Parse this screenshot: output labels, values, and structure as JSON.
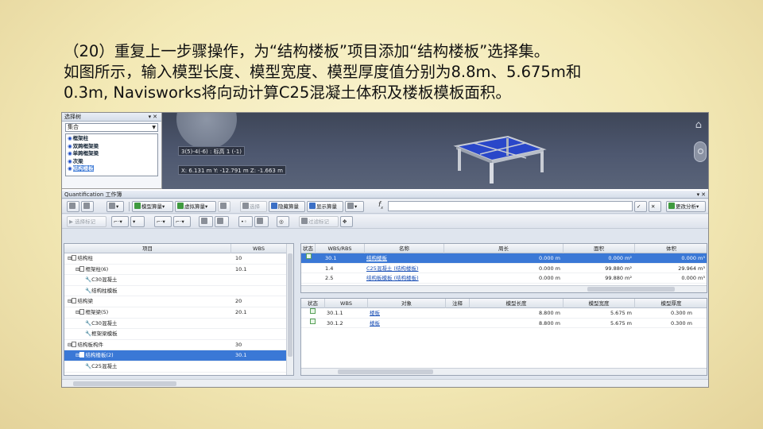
{
  "slide": {
    "line1": "（20）重复上一步骤操作，为“结构楼板”项目添加“结构楼板”选择集。",
    "line2": "如图所示，输入模型长度、模型宽度、模型厚度值分别为8.8m、5.675m和",
    "line3": "0.3m, Navisworks将向动计算C25混凝土体积及楼板模板面积。"
  },
  "selection_tree": {
    "title": "选择树",
    "dropdown_value": "集合",
    "items": [
      {
        "label": "框架柱"
      },
      {
        "label": "双跨框架梁"
      },
      {
        "label": "单跨框架梁"
      },
      {
        "label": "次梁"
      },
      {
        "label": "结构楼板",
        "selected": true
      }
    ]
  },
  "viewport": {
    "tip1": "3(5)-4(-6) : 标高 1 (-1)",
    "tip2": "X: 6.131 m  Y: -12.791 m  Z: -1.663 m"
  },
  "quantification": {
    "title": "Quantification 工作簿",
    "toolbar1": {
      "model_takeoff": "模型算量",
      "virtual_takeoff": "虚拟算量",
      "select": "选择",
      "hide_takeoff": "隐藏算量",
      "show_takeoff": "显示算量",
      "change_analysis": "更改分析"
    },
    "toolbar2": {
      "select_mark": "选择标记",
      "filter_mark": "过滤标记"
    },
    "fx": "f",
    "tree_headers": {
      "item": "项目",
      "wbs": "WBS"
    },
    "tree_rows": [
      {
        "label": "结构柱",
        "wbs": "10",
        "level": 0
      },
      {
        "label": "框架柱(6)",
        "wbs": "10.1",
        "level": 1
      },
      {
        "label": "C30混凝土",
        "wbs": "",
        "level": 2
      },
      {
        "label": "结构柱模板",
        "wbs": "",
        "level": 2
      },
      {
        "label": "结构梁",
        "wbs": "20",
        "level": 0
      },
      {
        "label": "框架梁(5)",
        "wbs": "20.1",
        "level": 1
      },
      {
        "label": "C30混凝土",
        "wbs": "",
        "level": 2
      },
      {
        "label": "框架梁模板",
        "wbs": "",
        "level": 2
      },
      {
        "label": "结构板构件",
        "wbs": "30",
        "level": 0
      },
      {
        "label": "结构楼板(2)",
        "wbs": "30.1",
        "level": 1,
        "selected": true
      },
      {
        "label": "C25混凝土",
        "wbs": "",
        "level": 2
      }
    ],
    "grid1_headers": {
      "status": "状态",
      "wbs": "WBS/RBS",
      "name": "名称",
      "perimeter": "周长",
      "area": "面积",
      "volume": "体积"
    },
    "grid1_rows": [
      {
        "wbs": "30.1",
        "name": "结构楼板",
        "perimeter": "0.000 m",
        "area": "0.000 m²",
        "volume": "0.000 m³",
        "selected": true
      },
      {
        "wbs": "1.4",
        "name": "C25混凝土 (结构楼板)",
        "perimeter": "0.000 m",
        "area": "99.880 m²",
        "volume": "29.964 m³"
      },
      {
        "wbs": "2.5",
        "name": "结构板模板 (结构楼板)",
        "perimeter": "0.000 m",
        "area": "99.880 m²",
        "volume": "0.000 m³"
      }
    ],
    "grid2_headers": {
      "status": "状态",
      "wbs": "WBS",
      "object": "对象",
      "note": "注释",
      "length": "模型长度",
      "width": "模型宽度",
      "thickness": "模型厚度"
    },
    "grid2_rows": [
      {
        "wbs": "30.1.1",
        "object": "楼板",
        "length": "8.800 m",
        "width": "5.675 m",
        "thickness": "0.300 m"
      },
      {
        "wbs": "30.1.2",
        "object": "楼板",
        "length": "8.800 m",
        "width": "5.675 m",
        "thickness": "0.300 m"
      }
    ]
  }
}
